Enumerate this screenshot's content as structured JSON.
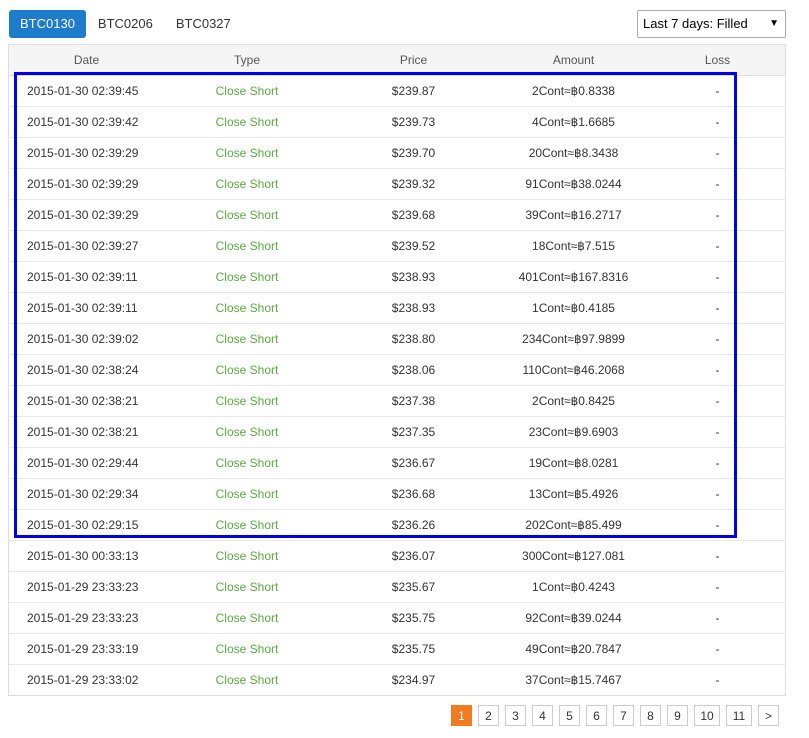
{
  "tabs": [
    {
      "label": "BTC0130",
      "active": true
    },
    {
      "label": "BTC0206",
      "active": false
    },
    {
      "label": "BTC0327",
      "active": false
    }
  ],
  "filter": {
    "selected": "Last 7 days: Filled",
    "caret_icon": "chevron-down-icon"
  },
  "table": {
    "headers": [
      "Date",
      "Type",
      "Price",
      "Amount",
      "Loss"
    ],
    "rows": [
      {
        "date": "2015-01-30 02:39:45",
        "type": "Close Short",
        "price": "$239.87",
        "amount": "2Cont≈฿0.8338",
        "loss": "-"
      },
      {
        "date": "2015-01-30 02:39:42",
        "type": "Close Short",
        "price": "$239.73",
        "amount": "4Cont≈฿1.6685",
        "loss": "-"
      },
      {
        "date": "2015-01-30 02:39:29",
        "type": "Close Short",
        "price": "$239.70",
        "amount": "20Cont≈฿8.3438",
        "loss": "-"
      },
      {
        "date": "2015-01-30 02:39:29",
        "type": "Close Short",
        "price": "$239.32",
        "amount": "91Cont≈฿38.0244",
        "loss": "-"
      },
      {
        "date": "2015-01-30 02:39:29",
        "type": "Close Short",
        "price": "$239.68",
        "amount": "39Cont≈฿16.2717",
        "loss": "-"
      },
      {
        "date": "2015-01-30 02:39:27",
        "type": "Close Short",
        "price": "$239.52",
        "amount": "18Cont≈฿7.515",
        "loss": "-"
      },
      {
        "date": "2015-01-30 02:39:11",
        "type": "Close Short",
        "price": "$238.93",
        "amount": "401Cont≈฿167.8316",
        "loss": "-"
      },
      {
        "date": "2015-01-30 02:39:11",
        "type": "Close Short",
        "price": "$238.93",
        "amount": "1Cont≈฿0.4185",
        "loss": "-"
      },
      {
        "date": "2015-01-30 02:39:02",
        "type": "Close Short",
        "price": "$238.80",
        "amount": "234Cont≈฿97.9899",
        "loss": "-"
      },
      {
        "date": "2015-01-30 02:38:24",
        "type": "Close Short",
        "price": "$238.06",
        "amount": "110Cont≈฿46.2068",
        "loss": "-"
      },
      {
        "date": "2015-01-30 02:38:21",
        "type": "Close Short",
        "price": "$237.38",
        "amount": "2Cont≈฿0.8425",
        "loss": "-"
      },
      {
        "date": "2015-01-30 02:38:21",
        "type": "Close Short",
        "price": "$237.35",
        "amount": "23Cont≈฿9.6903",
        "loss": "-"
      },
      {
        "date": "2015-01-30 02:29:44",
        "type": "Close Short",
        "price": "$236.67",
        "amount": "19Cont≈฿8.0281",
        "loss": "-"
      },
      {
        "date": "2015-01-30 02:29:34",
        "type": "Close Short",
        "price": "$236.68",
        "amount": "13Cont≈฿5.4926",
        "loss": "-"
      },
      {
        "date": "2015-01-30 02:29:15",
        "type": "Close Short",
        "price": "$236.26",
        "amount": "202Cont≈฿85.499",
        "loss": "-"
      },
      {
        "date": "2015-01-30 00:33:13",
        "type": "Close Short",
        "price": "$236.07",
        "amount": "300Cont≈฿127.081",
        "loss": "-"
      },
      {
        "date": "2015-01-29 23:33:23",
        "type": "Close Short",
        "price": "$235.67",
        "amount": "1Cont≈฿0.4243",
        "loss": "-"
      },
      {
        "date": "2015-01-29 23:33:23",
        "type": "Close Short",
        "price": "$235.75",
        "amount": "92Cont≈฿39.0244",
        "loss": "-"
      },
      {
        "date": "2015-01-29 23:33:19",
        "type": "Close Short",
        "price": "$235.75",
        "amount": "49Cont≈฿20.7847",
        "loss": "-"
      },
      {
        "date": "2015-01-29 23:33:02",
        "type": "Close Short",
        "price": "$234.97",
        "amount": "37Cont≈฿15.7467",
        "loss": "-"
      }
    ]
  },
  "pagination": {
    "pages": [
      "1",
      "2",
      "3",
      "4",
      "5",
      "6",
      "7",
      "8",
      "9",
      "10",
      "11"
    ],
    "current": "1",
    "next_label": ">"
  },
  "colors": {
    "active_tab": "#1d7ccc",
    "type_text": "#5aa940",
    "active_page": "#f07c1f",
    "highlight_box": "#0000e6"
  }
}
